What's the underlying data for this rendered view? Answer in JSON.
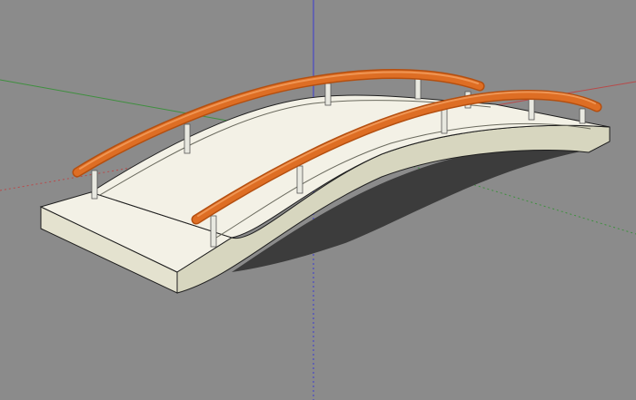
{
  "viewport": {
    "background_color": "#8b8b8b",
    "axes": {
      "red_axis_color": "#b84a4a",
      "green_axis_color": "#3f8f3f",
      "blue_axis_color": "#3b3bd0"
    }
  },
  "model": {
    "name": "",
    "deck_top_color": "#f3f1e6",
    "deck_side_color": "#d7d6bf",
    "deck_front_color": "#e4e2cf",
    "shadow_color": "#3c3c3c",
    "edge_color": "#1f1f1f",
    "railing_color": "#de6e24",
    "railing_highlight": "#ef9553",
    "post_color": "#e8e8e0"
  }
}
